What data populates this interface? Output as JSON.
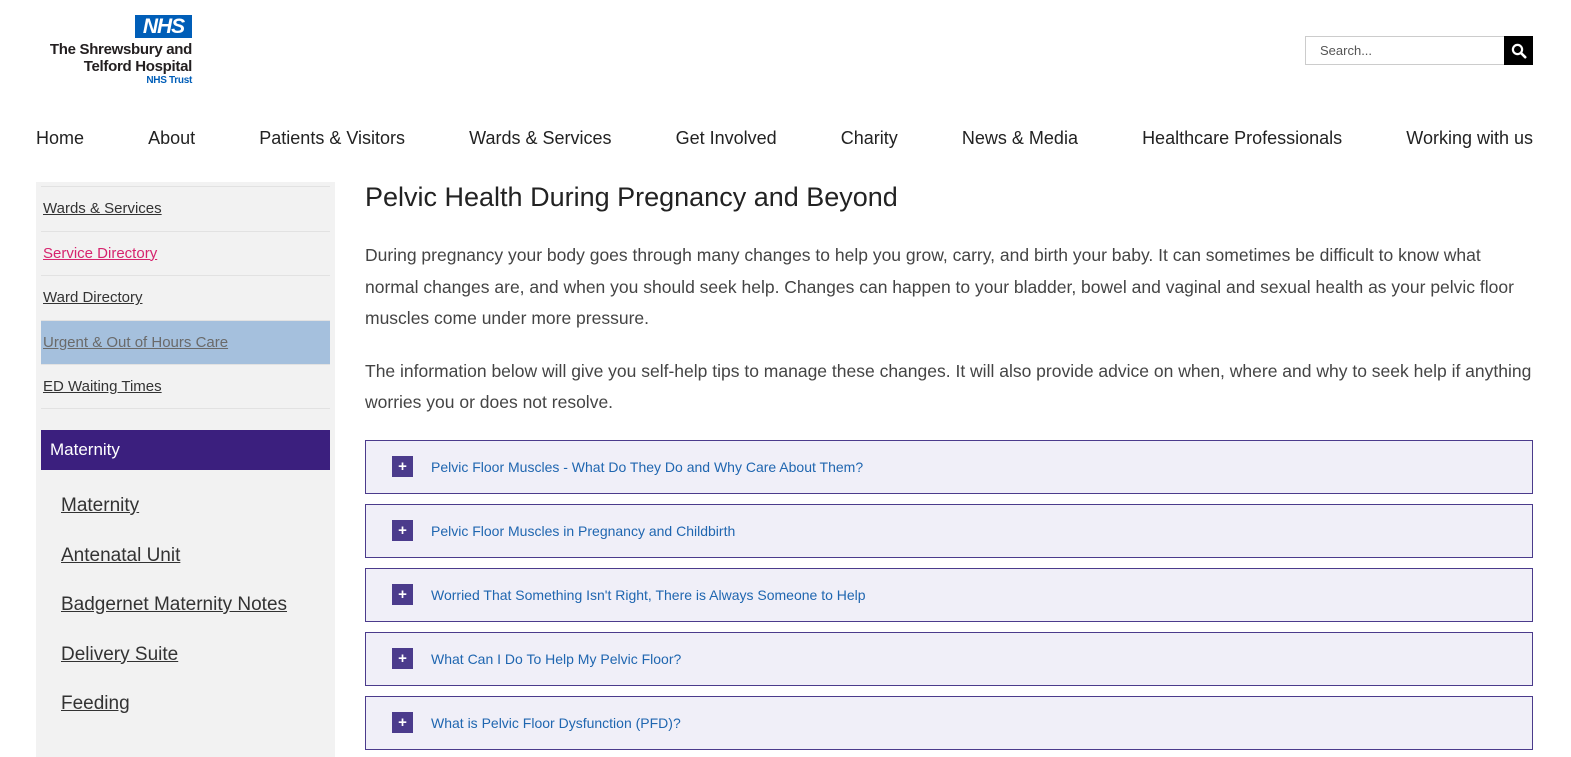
{
  "logo": {
    "badge": "NHS",
    "line1": "The Shrewsbury and",
    "line2": "Telford Hospital",
    "line3": "NHS Trust"
  },
  "search": {
    "placeholder": "Search...",
    "icon": "search-icon"
  },
  "topnav": [
    {
      "label": "Home"
    },
    {
      "label": "About"
    },
    {
      "label": "Patients & Visitors"
    },
    {
      "label": "Wards & Services"
    },
    {
      "label": "Get Involved"
    },
    {
      "label": "Charity"
    },
    {
      "label": "News & Media"
    },
    {
      "label": "Healthcare Professionals"
    },
    {
      "label": "Working with us"
    }
  ],
  "sidebar": {
    "items": [
      {
        "label": "Wards & Services"
      },
      {
        "label": "Service Directory"
      },
      {
        "label": "Ward Directory"
      },
      {
        "label": "Urgent & Out of Hours Care"
      },
      {
        "label": "ED Waiting Times"
      }
    ],
    "section_title": "Maternity",
    "sub_items": [
      {
        "label": "Maternity"
      },
      {
        "label": "Antenatal Unit"
      },
      {
        "label": "Badgernet Maternity Notes"
      },
      {
        "label": "Delivery Suite"
      },
      {
        "label": "Feeding"
      }
    ]
  },
  "main": {
    "title": "Pelvic Health During Pregnancy and Beyond",
    "paragraph1": "During pregnancy your body goes through many changes to help you grow, carry, and birth your baby. It can sometimes be difficult to know what normal changes are, and when you should seek help. Changes can happen to your bladder, bowel and vaginal and sexual health as your pelvic floor muscles come under more pressure.",
    "paragraph2": "The information below will give you self-help tips to manage these changes. It will also provide advice on when, where and why to seek help if anything worries you or does not resolve.",
    "accordion": [
      {
        "icon": "+",
        "title": "Pelvic Floor Muscles - What Do They Do and Why Care About Them?"
      },
      {
        "icon": "+",
        "title": "Pelvic Floor Muscles in Pregnancy and Childbirth"
      },
      {
        "icon": "+",
        "title": "Worried That Something Isn't Right, There is Always Someone to Help"
      },
      {
        "icon": "+",
        "title": "What Can I Do To Help My Pelvic Floor?"
      },
      {
        "icon": "+",
        "title": "What is Pelvic Floor Dysfunction (PFD)?"
      }
    ]
  },
  "colors": {
    "nhs_blue": "#005eb8",
    "maternity_purple": "#3b1f7e",
    "accordion_border": "#4b3b8c",
    "accordion_bg": "#f0eff8",
    "link_pink": "#d6246e",
    "active_bg": "#a5c0dd"
  }
}
